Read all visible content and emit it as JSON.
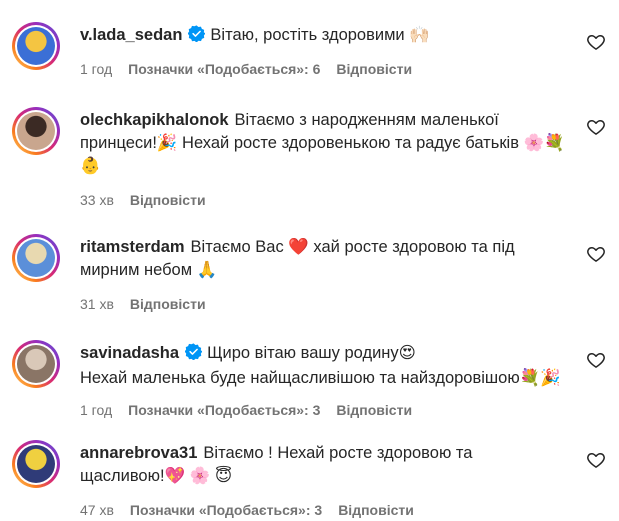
{
  "comments": [
    {
      "username": "v.lada_sedan",
      "verified": true,
      "lines": [
        "Вітаю, ростіть здоровими 🙌🏻"
      ],
      "time": "1 год",
      "likes": "Позначки «Подобається»: 6",
      "reply": "Відповісти",
      "avatar_colors": [
        "#f4c542",
        "#3b6fd6"
      ]
    },
    {
      "username": "olechkapikhalonok",
      "verified": false,
      "lines": [
        "Вітаємо з народженням маленької",
        "принцеси!🎉 Нехай росте здоровенькою та радує батьків 🌸💐",
        "👶"
      ],
      "time": "33 хв",
      "likes": "",
      "reply": "Відповісти",
      "avatar_colors": [
        "#3b2a24",
        "#c9a68e"
      ]
    },
    {
      "username": "ritamsterdam",
      "verified": false,
      "lines": [
        "Вітаємо Вас ❤️ хай росте здоровою та під",
        "мирним небом 🙏"
      ],
      "time": "31 хв",
      "likes": "",
      "reply": "Відповісти",
      "avatar_colors": [
        "#e8d9b0",
        "#5b8fd9"
      ]
    },
    {
      "username": "savinadasha",
      "verified": true,
      "lines": [
        "Щиро вітаю вашу родину😍",
        "Нехай маленька буде найщасливішою та найздоровішою💐🎉"
      ],
      "time": "1 год",
      "likes": "Позначки «Подобається»: 3",
      "reply": "Відповісти",
      "avatar_colors": [
        "#d9c8b8",
        "#8a7566"
      ]
    },
    {
      "username": "annarebrova31",
      "verified": false,
      "lines": [
        "Вітаємо ! Нехай росте здоровою та",
        "щасливою!💖 🌸 😇"
      ],
      "time": "47 хв",
      "likes": "Позначки «Подобається»: 3",
      "reply": "Відповісти",
      "avatar_colors": [
        "#f0d040",
        "#2f3b78"
      ]
    }
  ],
  "icons": {
    "heart": "heart-outline-icon",
    "verified": "verified-badge-icon"
  },
  "colors": {
    "text": "#262626",
    "meta": "#737373",
    "verified": "#0095f6"
  }
}
